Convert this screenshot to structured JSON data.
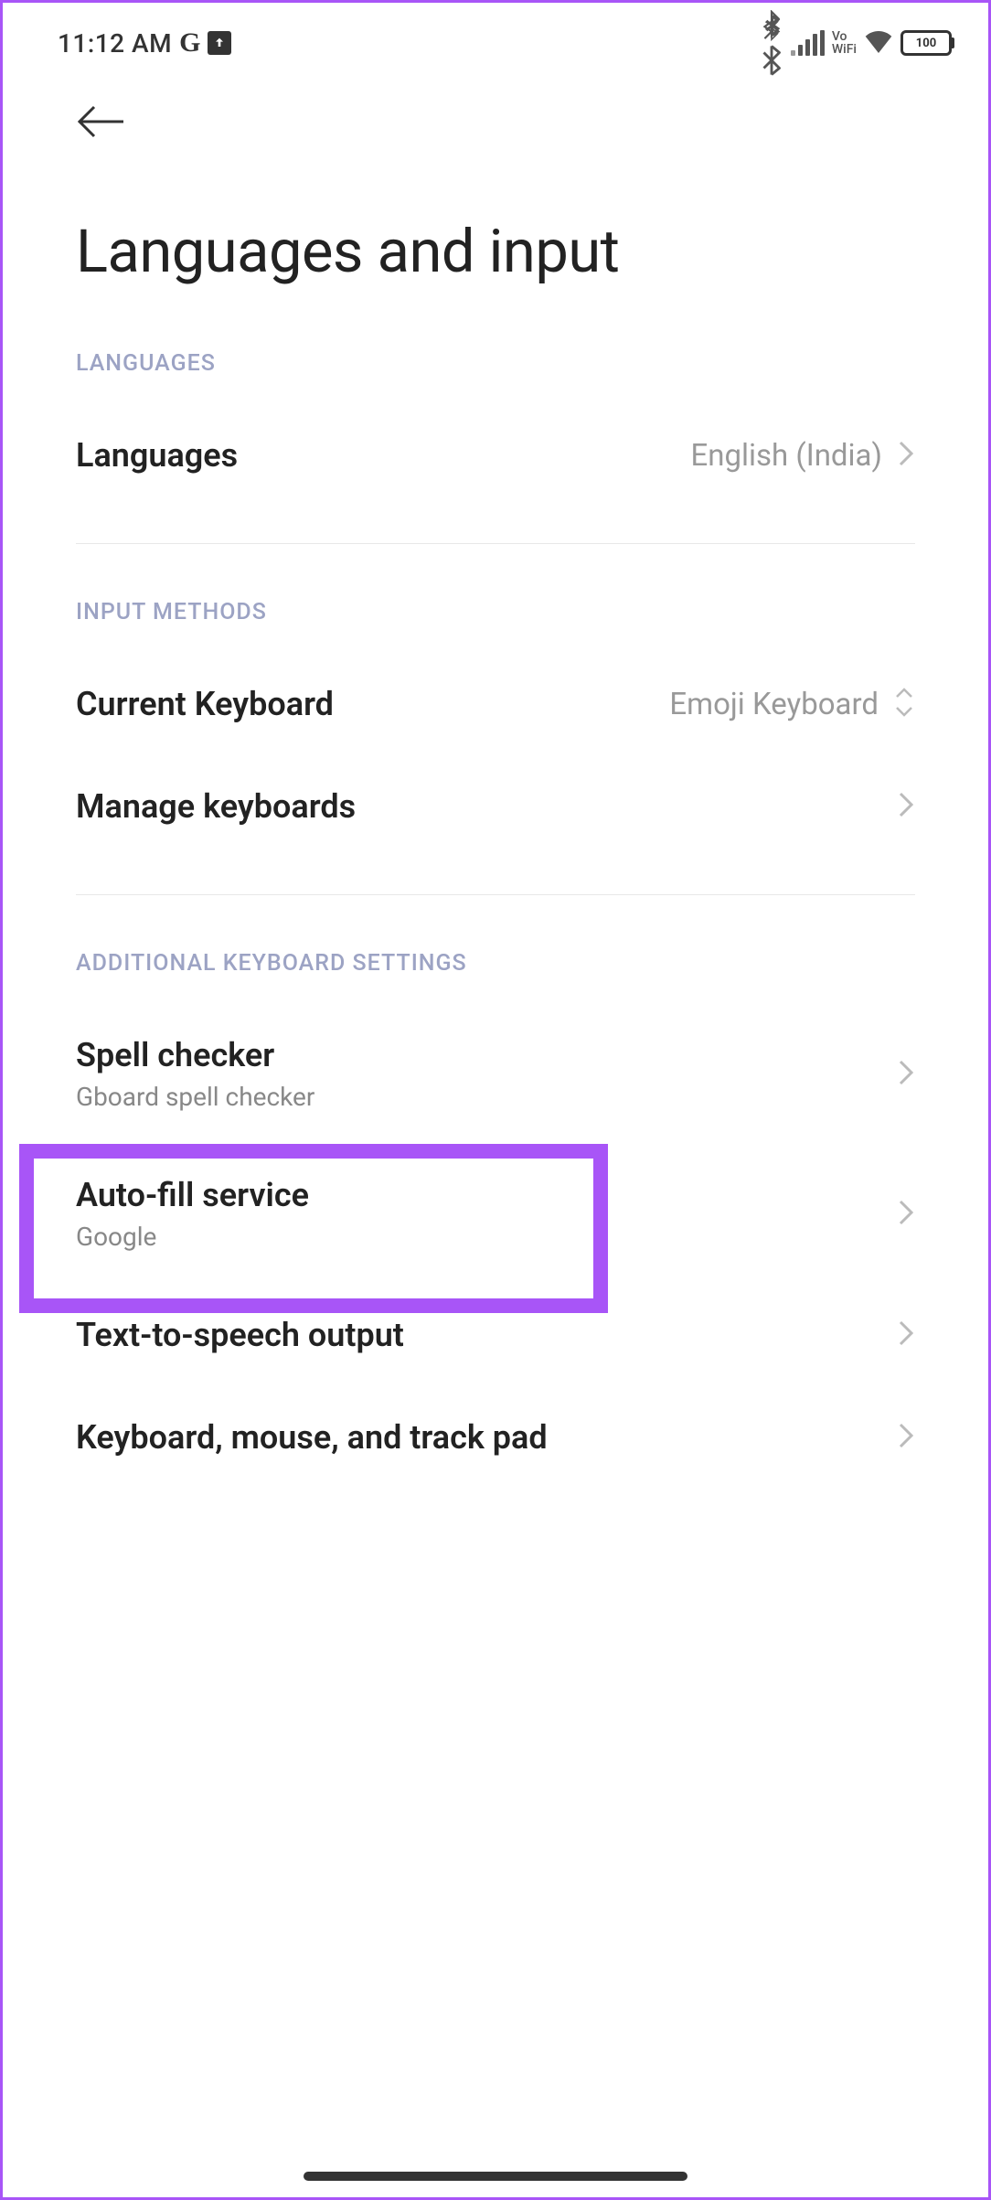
{
  "status_bar": {
    "time": "11:12 AM",
    "google_icon": "G",
    "vowifi_top": "Vo",
    "vowifi_bottom": "WiFi",
    "battery_level": "100"
  },
  "page": {
    "title": "Languages and input"
  },
  "sections": {
    "languages": {
      "header": "LANGUAGES",
      "items": [
        {
          "label": "Languages",
          "value": "English (India)"
        }
      ]
    },
    "input_methods": {
      "header": "INPUT METHODS",
      "items": [
        {
          "label": "Current Keyboard",
          "value": "Emoji Keyboard"
        },
        {
          "label": "Manage keyboards"
        }
      ]
    },
    "additional": {
      "header": "ADDITIONAL KEYBOARD SETTINGS",
      "items": [
        {
          "label": "Spell checker",
          "sublabel": "Gboard spell checker"
        },
        {
          "label": "Auto-fill service",
          "sublabel": "Google"
        },
        {
          "label": "Text-to-speech output"
        },
        {
          "label": "Keyboard, mouse, and track pad"
        }
      ]
    }
  }
}
